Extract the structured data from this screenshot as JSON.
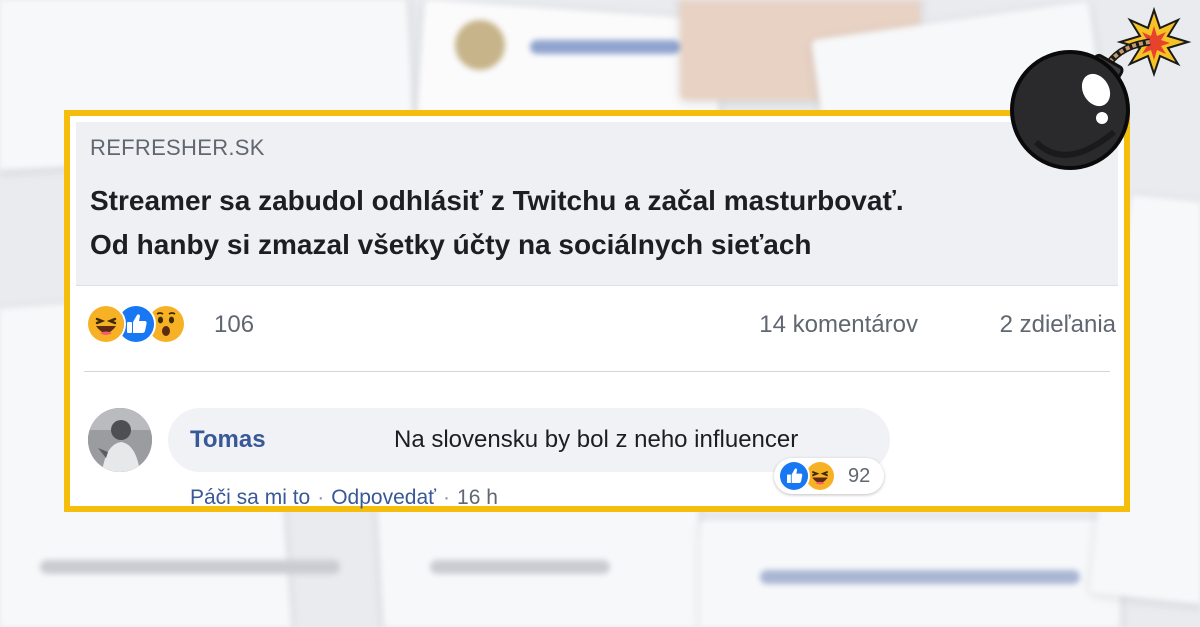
{
  "post": {
    "domain": "REFRESHER.SK",
    "headline_line1": "Streamer sa zabudol odhlásiť z Twitchu a začal masturbovať.",
    "headline_line2": "Od hanby si zmazal všetky účty na sociálnych sieťach",
    "reactions": [
      "haha",
      "like",
      "wow"
    ],
    "reaction_count": "106",
    "comments": "14 komentárov",
    "shares": "2 zdieľania"
  },
  "comment": {
    "author": "Tomas",
    "text": "Na slovensku by bol z neho influencer",
    "reactions": [
      "like",
      "haha"
    ],
    "reaction_count": "92",
    "like_action": "Páči sa mi to",
    "reply_action": "Odpovedať",
    "separator": "·",
    "time": "16 h"
  },
  "colors": {
    "frame": "#f5be0c",
    "link": "#385898",
    "like_blue": "#1877f2",
    "emoji_yellow": "#f7b125"
  },
  "decoration": {
    "icon": "bomb-icon"
  }
}
